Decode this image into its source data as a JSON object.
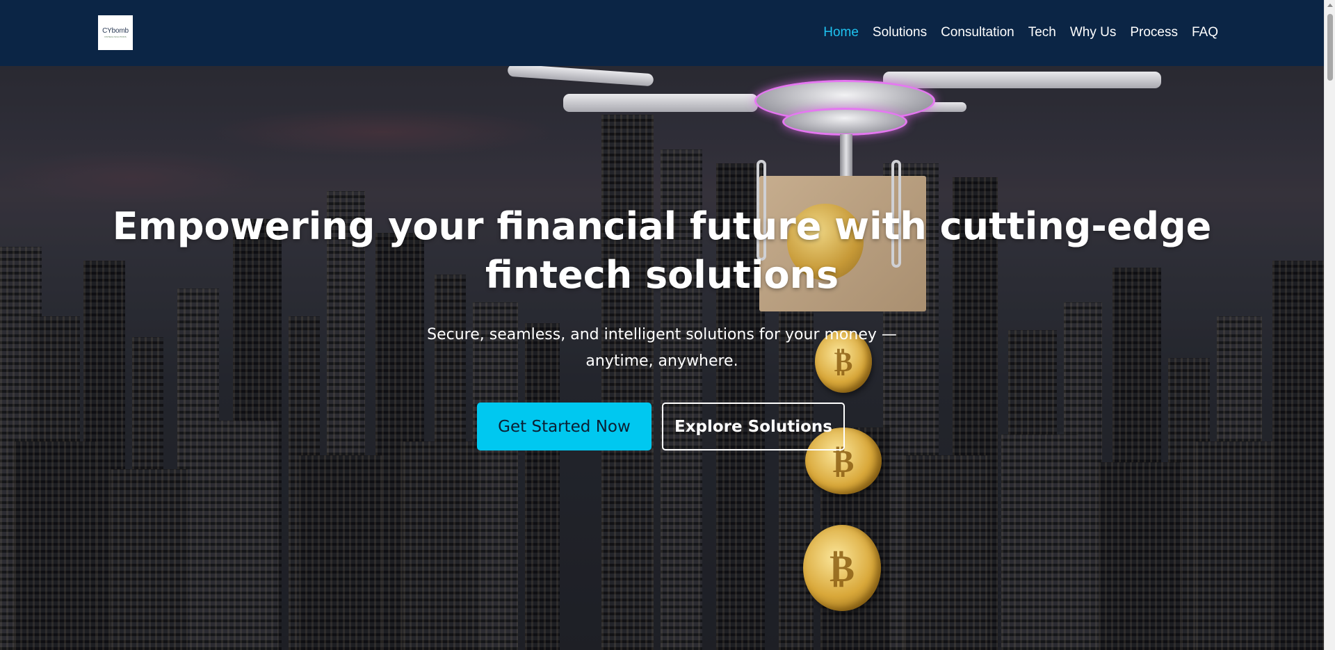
{
  "brand": {
    "logo_text": "CYbomb",
    "logo_subtext": "FINTECH SOLUTIONS"
  },
  "nav": {
    "items": [
      {
        "label": "Home",
        "active": true
      },
      {
        "label": "Solutions",
        "active": false
      },
      {
        "label": "Consultation",
        "active": false
      },
      {
        "label": "Tech",
        "active": false
      },
      {
        "label": "Why Us",
        "active": false
      },
      {
        "label": "Process",
        "active": false
      },
      {
        "label": "FAQ",
        "active": false
      }
    ]
  },
  "hero": {
    "title": "Empowering your financial future with cutting-edge fintech solutions",
    "subtitle": "Secure, seamless, and intelligent solutions for your money — anytime, anywhere.",
    "primary_button": "Get Started Now",
    "secondary_button": "Explore Solutions",
    "background_image": "drone-delivering-bitcoin-over-city",
    "coin_symbol": "₿"
  },
  "colors": {
    "navbar_bg": "#0b2545",
    "accent": "#00c8f0",
    "active_nav": "#1ec3f0",
    "text": "#ffffff"
  }
}
